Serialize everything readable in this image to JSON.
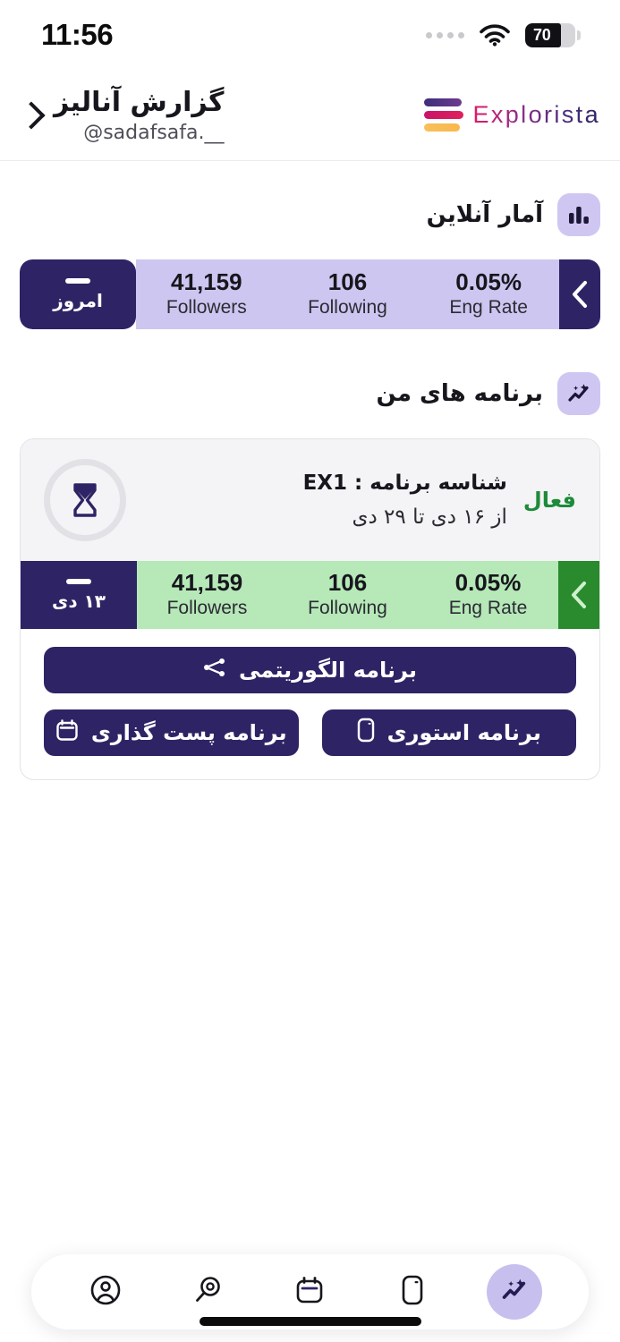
{
  "status_bar": {
    "time": "11:56",
    "battery_level": "70",
    "wifi_icon": "wifi-icon",
    "signal_icon": "signal-dots-icon"
  },
  "header": {
    "brand_name": "Explorista",
    "title": "گزارش آنالیز",
    "username": "@sadafsafa.__",
    "chevron_icon": "chevron-right-icon"
  },
  "online_stats": {
    "section_title": "آمار آنلاین",
    "section_icon": "bar-chart-icon",
    "prev_icon": "chevron-left-icon",
    "day_label": "امروز",
    "metrics": [
      {
        "value": "0.05%",
        "label": "Eng Rate"
      },
      {
        "value": "106",
        "label": "Following"
      },
      {
        "value": "41,159",
        "label": "Followers"
      }
    ]
  },
  "my_programs": {
    "section_title": "برنامه های من",
    "section_icon": "sparkle-chart-icon",
    "card": {
      "status": "فعال",
      "program_id": "شناسه برنامه : EX1",
      "date_range": "از ۱۶ دی تا ۲۹ دی",
      "timer_icon": "hourglass-icon",
      "prev_icon": "chevron-left-icon",
      "day_label": "۱۳ دی",
      "metrics": [
        {
          "value": "0.05%",
          "label": "Eng Rate"
        },
        {
          "value": "106",
          "label": "Following"
        },
        {
          "value": "41,159",
          "label": "Followers"
        }
      ],
      "actions": {
        "algorithmic": {
          "label": "برنامه الگوریتمی",
          "icon": "branch-network-icon"
        },
        "posting": {
          "label": "برنامه پست گذاری",
          "icon": "calendar-icon"
        },
        "story": {
          "label": "برنامه استوری",
          "icon": "phone-story-icon"
        }
      }
    }
  },
  "bottom_nav": {
    "items": [
      {
        "name": "profile",
        "icon": "user-circle-icon",
        "active": false
      },
      {
        "name": "search",
        "icon": "search-icon",
        "active": false
      },
      {
        "name": "calendar",
        "icon": "calendar-icon",
        "active": false
      },
      {
        "name": "story",
        "icon": "phone-story-icon",
        "active": false
      },
      {
        "name": "analytics",
        "icon": "sparkle-chart-icon",
        "active": true
      }
    ]
  },
  "colors": {
    "primary_dark": "#2e2465",
    "accent_light_purple": "#cdc6f0",
    "accent_green": "#1e8b3a",
    "green_strip": "#b6e8b8",
    "green_arrow": "#2a8a2e",
    "brand_pink": "#e01a6b",
    "brand_orange": "#f7c05a"
  }
}
